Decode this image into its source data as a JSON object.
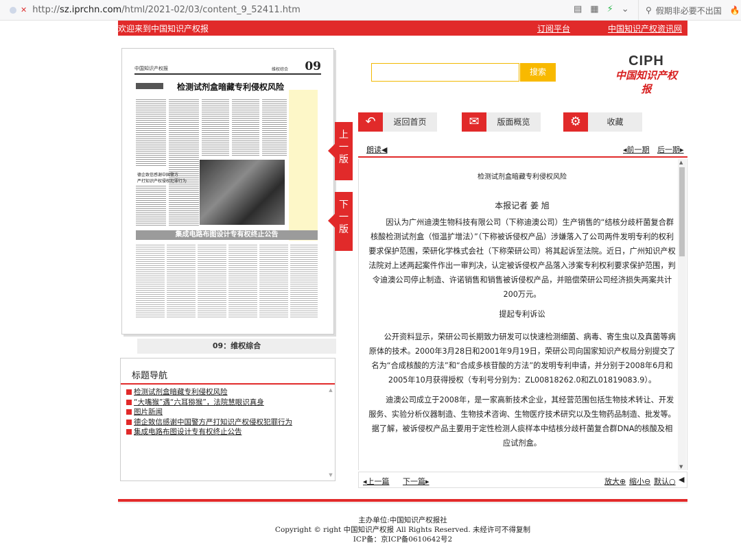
{
  "browser": {
    "url_prefix": "http://",
    "url_domain": "sz.iprchn.com",
    "url_path": "/html/2021-02/03/content_9_52411.htm",
    "search_text": "假期非必要不出国",
    "icons": [
      "reader-icon",
      "grid-icon",
      "bolt-icon",
      "chevron-down-icon",
      "search-icon",
      "flame-icon"
    ]
  },
  "topbar": {
    "welcome": "欢迎来到中国知识产权报",
    "link1": "订阅平台",
    "link2": "中国知识产权资讯网"
  },
  "newspaper": {
    "masthead_logo": "中国知识产权报",
    "section": "维权综合",
    "page_no": "09",
    "headline": "检测试剂盒暗藏专利侵权风险",
    "subhead_1": "德企致信感谢中国警方",
    "subhead_2": "严打知识产权侵权犯罪行为",
    "banner": "集成电路布图设计专有权终止公告",
    "caption": "09：维权综合"
  },
  "tabs": {
    "prev": "上一版",
    "next": "下一版"
  },
  "titlenav": {
    "header": "标题导航",
    "items": [
      "检测试剂盒暗藏专利侵权风险",
      "“大嘴猴”遇“六耳猕猴”，法院慧眼识真身",
      "图片新闻",
      "德企致信感谢中国警方严打知识产权侵权犯罪行为",
      "集成电路布图设计专有权终止公告"
    ]
  },
  "search": {
    "button": "搜索",
    "value": ""
  },
  "brand": {
    "latin": "CIPH",
    "cn": "中国知识产权报"
  },
  "actions": {
    "home": "返回首页",
    "overview": "版面概览",
    "favorite": "收藏"
  },
  "article": {
    "read_aloud": "朗读",
    "prev_article": "前一期",
    "next_article": "后一期",
    "title": "检测试剂盒暗藏专利侵权风险",
    "author": "本报记者 姜 旭",
    "para1": "因认为广州迪澳生物科技有限公司（下称迪澳公司）生产销售的“结核分歧杆菌复合群核酸检测试剂盒（恒温扩增法）”（下称被诉侵权产品）涉嫌落入了公司两件发明专利的权利要求保护范围，荣研化学株式会社（下称荣研公司）将其起诉至法院。近日，广州知识产权法院对上述两起案件作出一审判决，认定被诉侵权产品落入涉案专利权利要求保护范围，判令迪澳公司停止制造、许诺销售和销售被诉侵权产品，并赔偿荣研公司经济损失两案共计200万元。",
    "subhead": "提起专利诉讼",
    "para2": "公开资料显示，荣研公司长期致力研发可以快速检测细菌、病毒、寄生虫以及真菌等病原体的技术。2000年3月28日和2001年9月19日，荣研公司向国家知识产权局分别提交了名为“合成核酸的方法”和“合成多核苷酸的方法”的发明专利申请，并分别于2008年6月和2005年10月获得授权（专利号分别为：ZL00818262.0和ZL01819083.9）。",
    "para3": "迪澳公司成立于2008年，是一家高新技术企业，其经营范围包括生物技术转让、开发服务、实验分析仪器制造、生物技术咨询、生物医疗技术研究以及生物药品制造、批发等。据了解，被诉侵权产品主要用于定性检测人痰样本中结核分歧杆菌复合群DNA的核酸及相应试剂盒。",
    "footer_prev": "上一篇",
    "footer_next": "下一篇",
    "zoom_in": "放大",
    "zoom_out": "缩小",
    "default": "默认"
  },
  "footer": {
    "line1": "主办单位:中国知识产权报社",
    "line2": "Copyright © right 中国知识产权报 All Rights Reserved. 未经许可不得复制",
    "line3": "ICP备：京ICP备0610642号2"
  },
  "colors": {
    "accent": "#e12a2a",
    "search": "#f8b900"
  }
}
